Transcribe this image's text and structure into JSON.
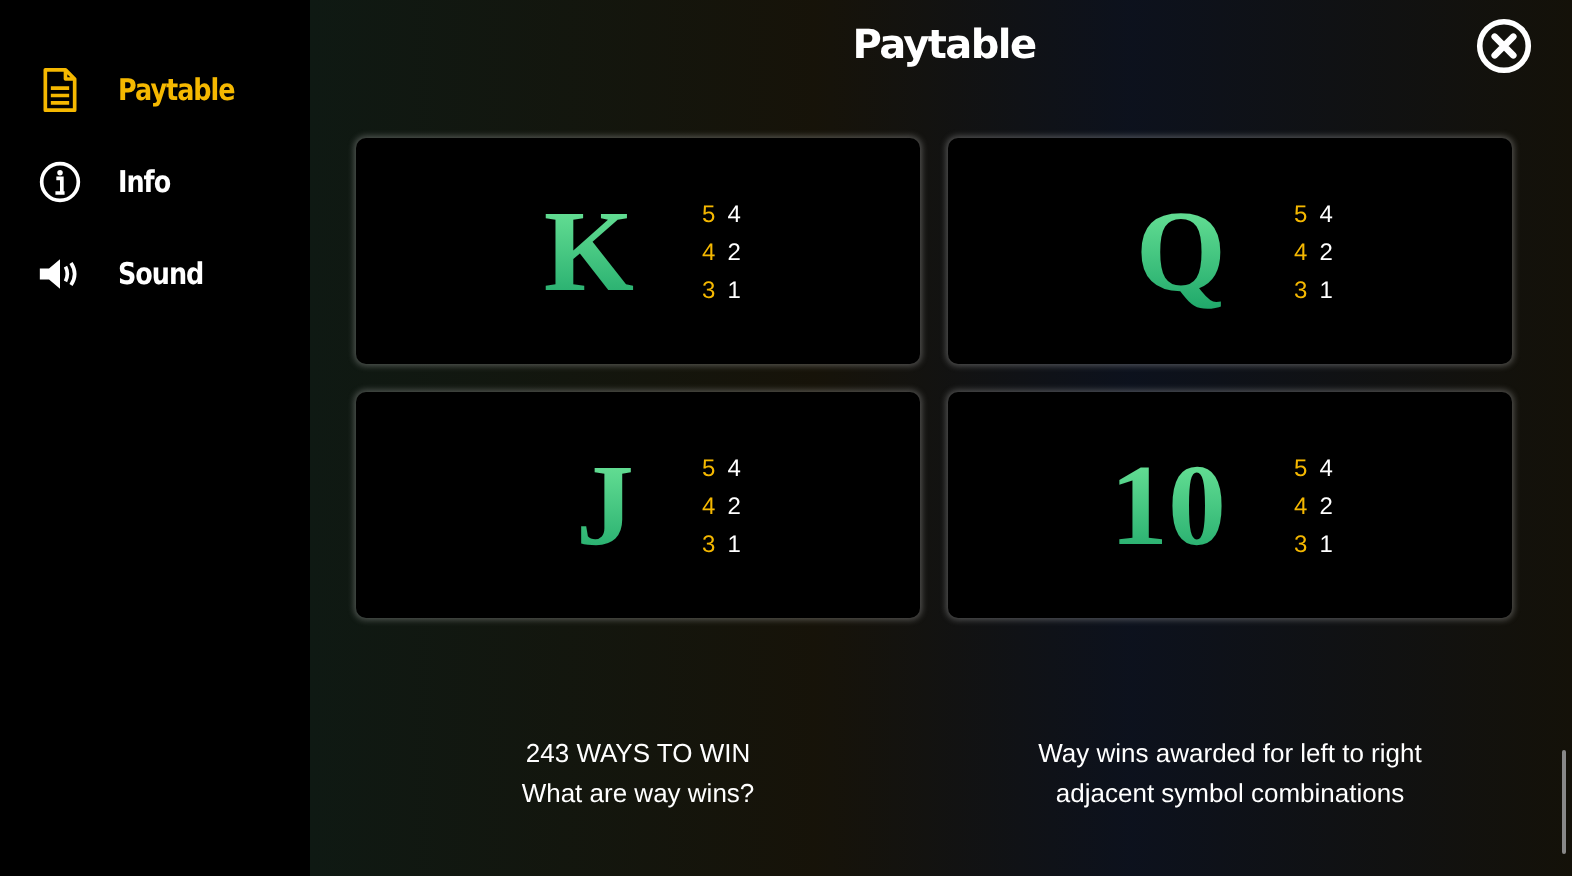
{
  "sidebar": {
    "items": [
      {
        "kind": "document",
        "label": "Paytable",
        "selected": true
      },
      {
        "kind": "info",
        "label": "Info",
        "selected": false
      },
      {
        "kind": "sound",
        "label": "Sound",
        "selected": false
      }
    ]
  },
  "title": "Paytable",
  "symbols": [
    {
      "symbol": "K",
      "pays": [
        {
          "count": "5",
          "amount": "4"
        },
        {
          "count": "4",
          "amount": "2"
        },
        {
          "count": "3",
          "amount": "1"
        }
      ]
    },
    {
      "symbol": "Q",
      "pays": [
        {
          "count": "5",
          "amount": "4"
        },
        {
          "count": "4",
          "amount": "2"
        },
        {
          "count": "3",
          "amount": "1"
        }
      ]
    },
    {
      "symbol": "J",
      "pays": [
        {
          "count": "5",
          "amount": "4"
        },
        {
          "count": "4",
          "amount": "2"
        },
        {
          "count": "3",
          "amount": "1"
        }
      ]
    },
    {
      "symbol": "10",
      "pays": [
        {
          "count": "5",
          "amount": "4"
        },
        {
          "count": "4",
          "amount": "2"
        },
        {
          "count": "3",
          "amount": "1"
        }
      ]
    }
  ],
  "notes": [
    {
      "heading": "243 WAYS TO WIN",
      "text": "What are way wins?"
    },
    {
      "text": "Way wins awarded for left to right adjacent symbol combinations"
    }
  ]
}
